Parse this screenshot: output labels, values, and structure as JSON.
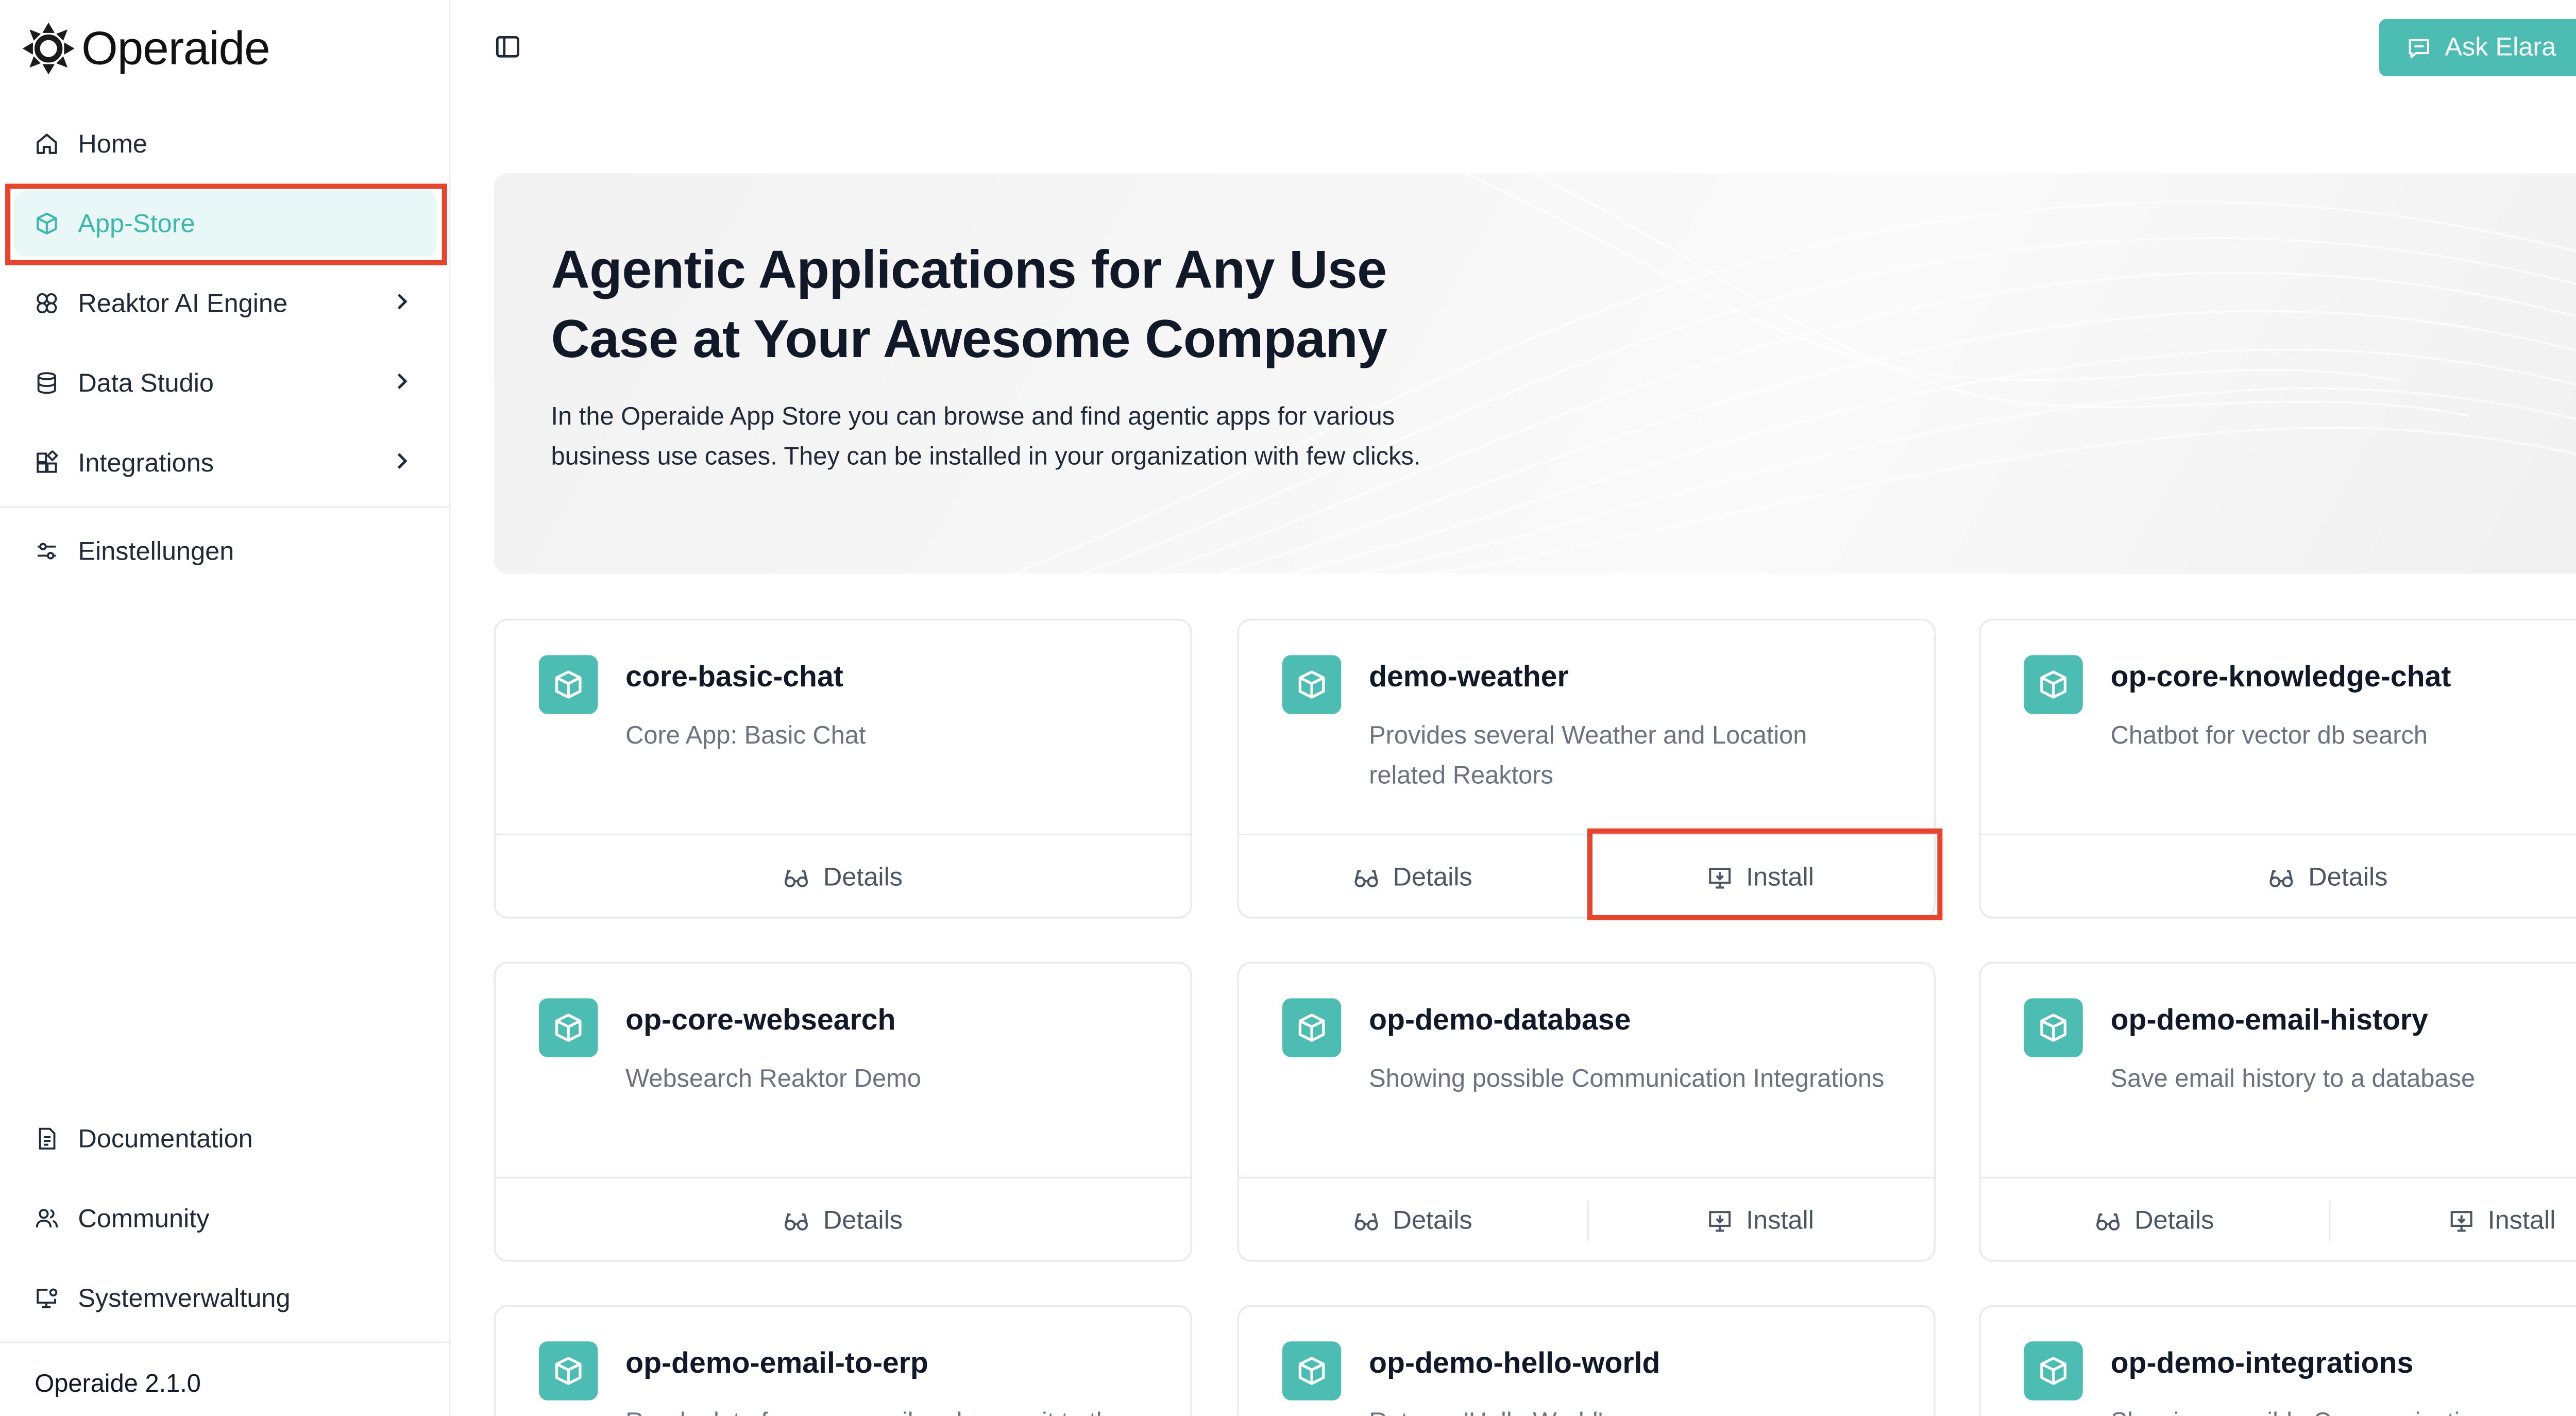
{
  "app": {
    "logo_text": "Operaide",
    "version": "Operaide 2.1.0"
  },
  "sidebar": {
    "items": [
      {
        "label": "Home",
        "icon": "home-icon"
      },
      {
        "label": "App-Store",
        "icon": "cube-icon",
        "active": true
      },
      {
        "label": "Reaktor AI Engine",
        "icon": "ai-engine-icon",
        "has_submenu": true
      },
      {
        "label": "Data Studio",
        "icon": "database-icon",
        "has_submenu": true
      },
      {
        "label": "Integrations",
        "icon": "integrations-icon",
        "has_submenu": true
      },
      {
        "label": "Einstellungen",
        "icon": "settings-sliders-icon"
      }
    ],
    "bottom_items": [
      {
        "label": "Documentation",
        "icon": "document-icon"
      },
      {
        "label": "Community",
        "icon": "users-icon"
      },
      {
        "label": "Systemverwaltung",
        "icon": "monitor-settings-icon"
      }
    ]
  },
  "header": {
    "ask_button": "Ask Elara"
  },
  "hero": {
    "title": "Agentic Applications for Any Use Case at Your Awesome Company",
    "description": "In the Operaide App Store you can browse and find agentic apps for various business use cases. They can be installed in your organization with few clicks."
  },
  "actions": {
    "details": "Details",
    "install": "Install"
  },
  "apps": [
    {
      "name": "core-basic-chat",
      "description": "Core App: Basic Chat",
      "installable": false
    },
    {
      "name": "demo-weather",
      "description": "Provides several Weather and Location related Reaktors",
      "installable": true
    },
    {
      "name": "op-core-knowledge-chat",
      "description": "Chatbot for vector db search",
      "installable": false
    },
    {
      "name": "op-core-websearch",
      "description": "Websearch Reaktor Demo",
      "installable": false
    },
    {
      "name": "op-demo-database",
      "description": "Showing possible Communication Integrations",
      "installable": true
    },
    {
      "name": "op-demo-email-history",
      "description": "Save email history to a database",
      "installable": true
    },
    {
      "name": "op-demo-email-to-erp",
      "description": "Reads data from an email and saves it to the",
      "installable": null
    },
    {
      "name": "op-demo-hello-world",
      "description": "Returns 'Hello World'",
      "installable": null
    },
    {
      "name": "op-demo-integrations",
      "description": "Showing possible Communication",
      "installable": null
    }
  ],
  "colors": {
    "accent": "#4dbdb3",
    "active_bg": "#e9f8f7",
    "highlight": "#e5442f"
  }
}
